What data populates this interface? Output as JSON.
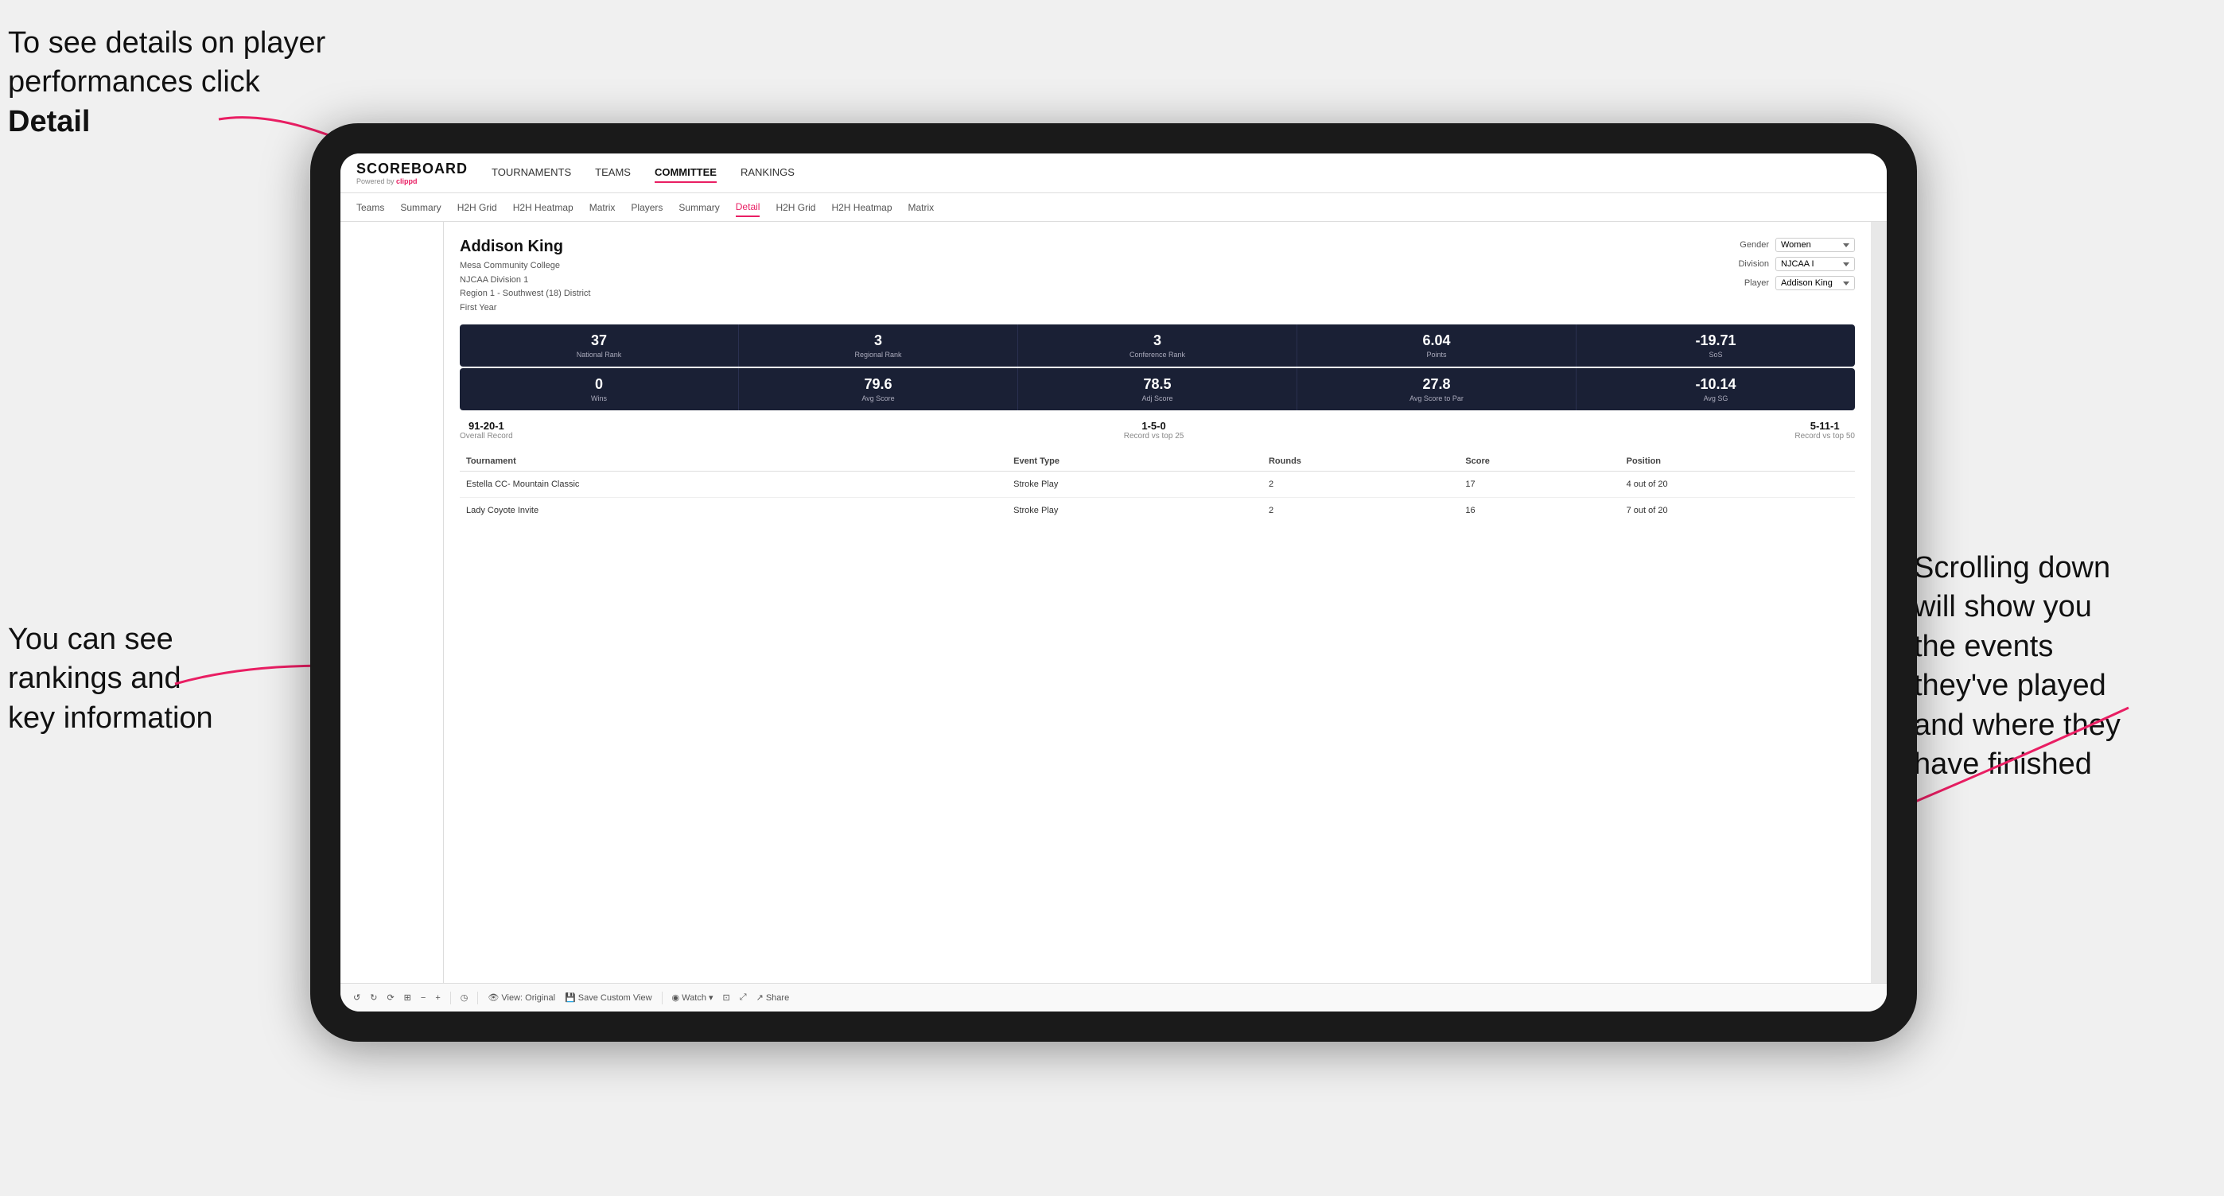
{
  "annotations": {
    "topleft": "To see details on player performances click ",
    "topleft_bold": "Detail",
    "bottomleft_line1": "You can see",
    "bottomleft_line2": "rankings and",
    "bottomleft_line3": "key information",
    "bottomright_line1": "Scrolling down",
    "bottomright_line2": "will show you",
    "bottomright_line3": "the events",
    "bottomright_line4": "they've played",
    "bottomright_line5": "and where they",
    "bottomright_line6": "have finished"
  },
  "topnav": {
    "logo": "SCOREBOARD",
    "powered_by": "Powered by",
    "clippd": "clippd",
    "links": [
      "TOURNAMENTS",
      "TEAMS",
      "COMMITTEE",
      "RANKINGS"
    ]
  },
  "subnav": {
    "links": [
      "Teams",
      "Summary",
      "H2H Grid",
      "H2H Heatmap",
      "Matrix",
      "Players",
      "Summary",
      "Detail",
      "H2H Grid",
      "H2H Heatmap",
      "Matrix"
    ],
    "active": "Detail"
  },
  "player": {
    "name": "Addison King",
    "school": "Mesa Community College",
    "division": "NJCAA Division 1",
    "region": "Region 1 - Southwest (18) District",
    "year": "First Year"
  },
  "filters": {
    "gender_label": "Gender",
    "gender_value": "Women",
    "division_label": "Division",
    "division_value": "NJCAA I",
    "player_label": "Player",
    "player_value": "Addison King"
  },
  "stats_row1": [
    {
      "value": "37",
      "label": "National Rank"
    },
    {
      "value": "3",
      "label": "Regional Rank"
    },
    {
      "value": "3",
      "label": "Conference Rank"
    },
    {
      "value": "6.04",
      "label": "Points"
    },
    {
      "value": "-19.71",
      "label": "SoS"
    }
  ],
  "stats_row2": [
    {
      "value": "0",
      "label": "Wins"
    },
    {
      "value": "79.6",
      "label": "Avg Score"
    },
    {
      "value": "78.5",
      "label": "Adj Score"
    },
    {
      "value": "27.8",
      "label": "Avg Score to Par"
    },
    {
      "value": "-10.14",
      "label": "Avg SG"
    }
  ],
  "records": [
    {
      "value": "91-20-1",
      "label": "Overall Record"
    },
    {
      "value": "1-5-0",
      "label": "Record vs top 25"
    },
    {
      "value": "5-11-1",
      "label": "Record vs top 50"
    }
  ],
  "table": {
    "headers": [
      "Tournament",
      "Event Type",
      "Rounds",
      "Score",
      "Position"
    ],
    "rows": [
      {
        "tournament": "Estella CC- Mountain Classic",
        "event_type": "Stroke Play",
        "rounds": "2",
        "score": "17",
        "position": "4 out of 20"
      },
      {
        "tournament": "Lady Coyote Invite",
        "event_type": "Stroke Play",
        "rounds": "2",
        "score": "16",
        "position": "7 out of 20"
      }
    ]
  },
  "toolbar": {
    "buttons": [
      "⟵",
      "⟶",
      "⟳",
      "⊞",
      "⊟",
      "⊠",
      "◷",
      "View: Original",
      "Save Custom View",
      "Watch ▾",
      "⊡",
      "⊞",
      "Share"
    ]
  }
}
